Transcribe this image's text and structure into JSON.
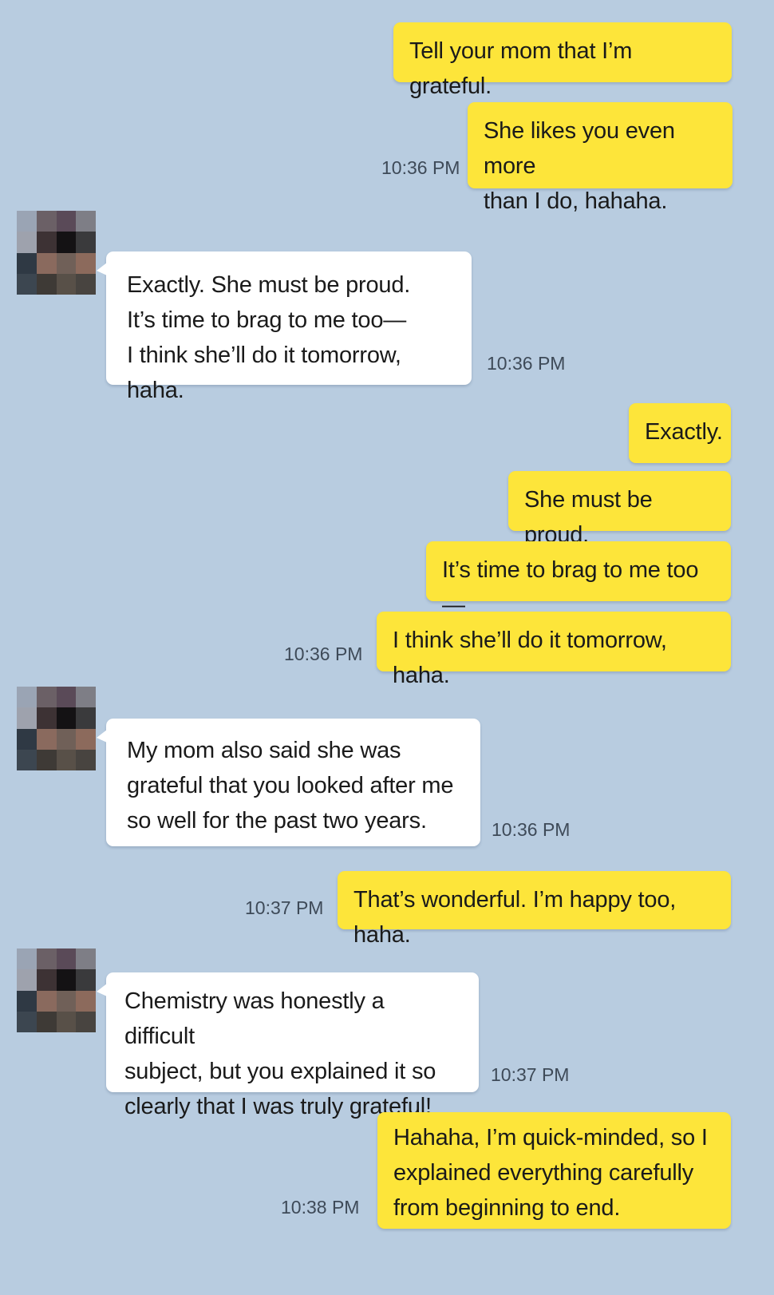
{
  "messages": [
    {
      "from": "me",
      "text": "Tell your mom that I’m grateful.",
      "time": ""
    },
    {
      "from": "me",
      "text": "She likes you even more\nthan I do, hahaha.",
      "time": "10:36 PM"
    },
    {
      "from": "them",
      "text": "Exactly. She must be proud.\nIt’s time to brag to me too—\nI think she’ll do it tomorrow, haha.",
      "time": "10:36 PM"
    },
    {
      "from": "me",
      "text": "Exactly.",
      "time": ""
    },
    {
      "from": "me",
      "text": "She must be proud.",
      "time": ""
    },
    {
      "from": "me",
      "text": "It’s time to brag to me too—",
      "time": ""
    },
    {
      "from": "me",
      "text": "I think she’ll do it tomorrow, haha.",
      "time": "10:36 PM"
    },
    {
      "from": "them",
      "text": "My mom also said she was\ngrateful that you looked after me\nso well for the past two years.",
      "time": "10:36 PM"
    },
    {
      "from": "me",
      "text": "That’s wonderful. I’m happy too, haha.",
      "time": "10:37 PM"
    },
    {
      "from": "them",
      "text": "Chemistry was honestly a difficult\nsubject, but you explained it so\nclearly that I was truly grateful!",
      "time": "10:37 PM"
    },
    {
      "from": "me",
      "text": "Hahaha, I’m quick-minded, so I\nexplained everything carefully\nfrom beginning to end.",
      "time": "10:38 PM"
    }
  ],
  "avatar": {
    "icon": "pixelated-avatar-icon",
    "colors": [
      "#9aa4b4",
      "#6b6066",
      "#5a4a58",
      "#7e7e86",
      "#9ea2ad",
      "#3d3234",
      "#141214",
      "#3a3a3c",
      "#2f3944",
      "#8a6a5e",
      "#706058",
      "#8c6a5c",
      "#3c4650",
      "#3e3a36",
      "#585048",
      "#484440"
    ]
  },
  "theme": {
    "background": "#b8cce0",
    "my_bubble": "#fde53a",
    "their_bubble": "#ffffff"
  }
}
